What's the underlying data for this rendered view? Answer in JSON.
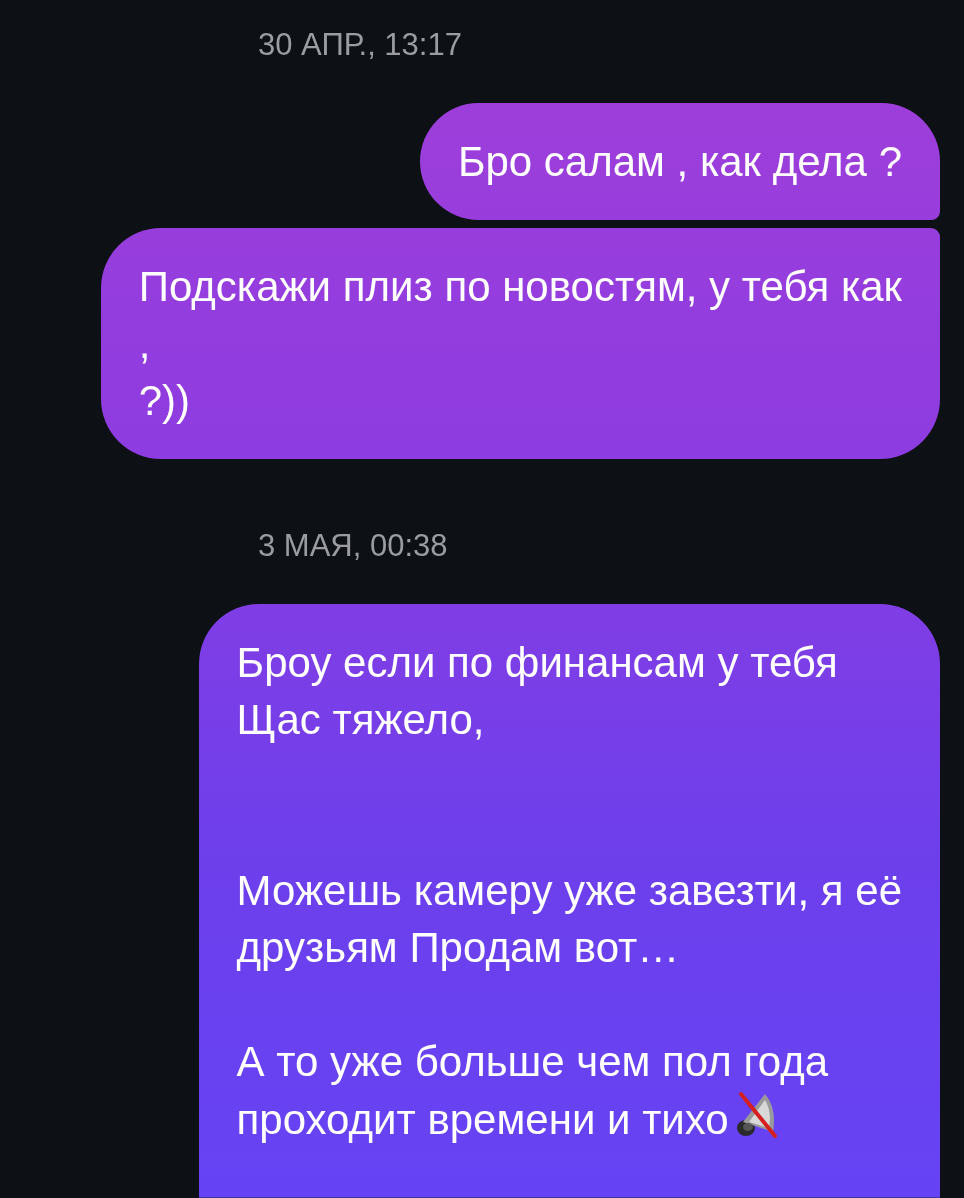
{
  "conversation": [
    {
      "kind": "timestamp",
      "text": "30 АПР., 13:17"
    },
    {
      "kind": "message",
      "text": "Бро салам , как дела ?",
      "joined_below": true,
      "joined_above": false,
      "muted_icon": false
    },
    {
      "kind": "message",
      "text": "Подскажи плиз по новостям, у тебя как\n,\n?))",
      "joined_below": false,
      "joined_above": true,
      "muted_icon": false
    },
    {
      "kind": "timestamp",
      "text": "3 МАЯ, 00:38"
    },
    {
      "kind": "message",
      "text": "Броу если по финансам у тебя\nЩас тяжело,\n\n\nМожешь камеру уже завезти, я её\nдрузьям Продам вот…\n\nА то уже больше чем пол года\nпроходит времени и тихо",
      "joined_below": false,
      "joined_above": false,
      "muted_icon": true
    }
  ]
}
